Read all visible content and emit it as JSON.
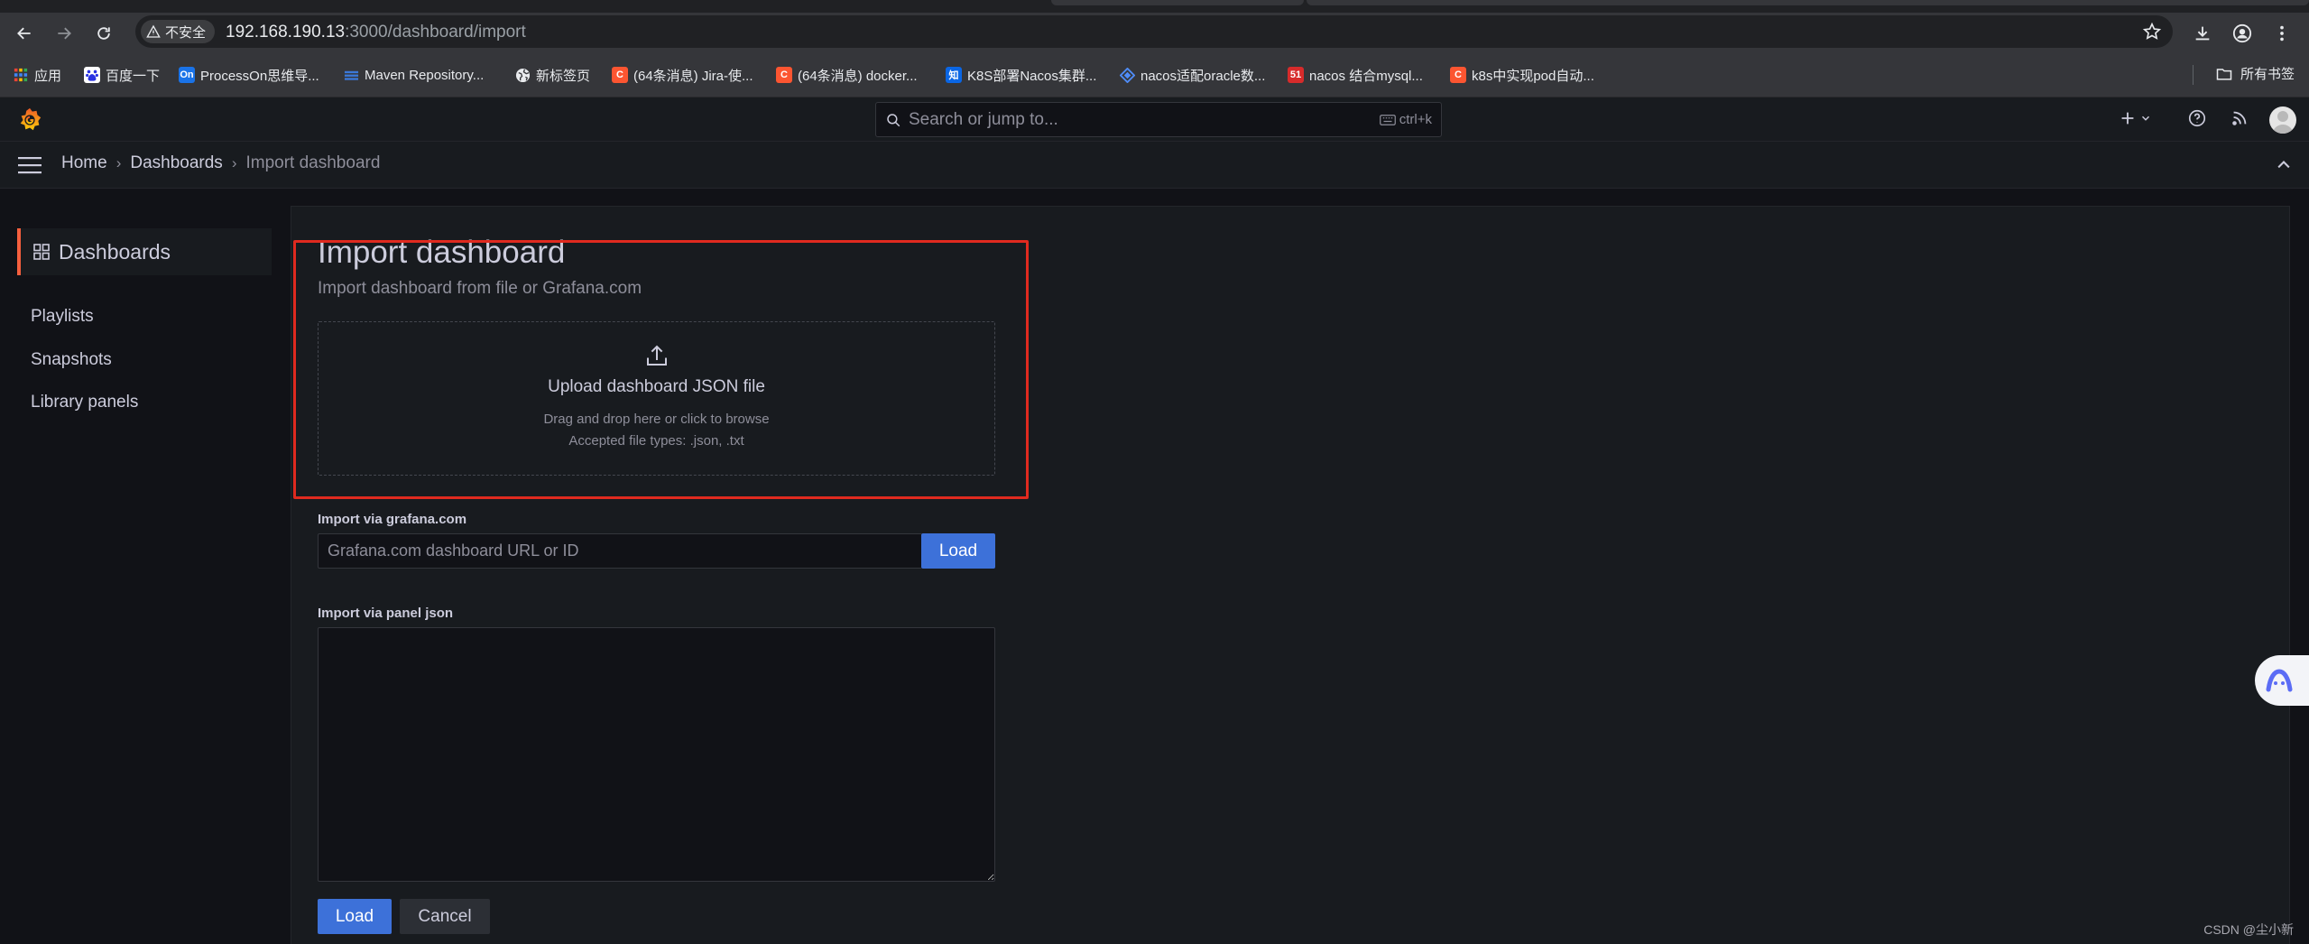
{
  "browser": {
    "security_label": "不安全",
    "url_host": "192.168.190.13",
    "url_path": ":3000/dashboard/import",
    "bookmarks": [
      {
        "label": "应用",
        "icon": "apps-grid-icon",
        "color": "#e8eaed"
      },
      {
        "label": "百度一下",
        "icon": "baidu-icon",
        "color": "#2932e1"
      },
      {
        "label": "ProcessOn思维导...",
        "icon": "processon-icon",
        "color": "#1a73e8",
        "glyph": "On"
      },
      {
        "label": "Maven Repository...",
        "icon": "maven-icon",
        "color": "#3b78d8"
      },
      {
        "label": "新标签页",
        "icon": "globe-icon",
        "color": "#e8eaed"
      },
      {
        "label": "(64条消息) Jira-使...",
        "icon": "csdn-icon",
        "color": "#fc5531",
        "glyph": "C"
      },
      {
        "label": "(64条消息) docker...",
        "icon": "csdn-icon",
        "color": "#fc5531",
        "glyph": "C"
      },
      {
        "label": "K8S部署Nacos集群...",
        "icon": "zhihu-icon",
        "color": "#0a66e5",
        "glyph": "知"
      },
      {
        "label": "nacos适配oracle数...",
        "icon": "diamond-icon",
        "color": "#4f8cf7"
      },
      {
        "label": "nacos 结合mysql...",
        "icon": "51cto-icon",
        "color": "#d72b2b",
        "glyph": "51"
      },
      {
        "label": "k8s中实现pod自动...",
        "icon": "csdn-icon",
        "color": "#fc5531",
        "glyph": "C"
      }
    ],
    "all_bookmarks": "所有书签"
  },
  "grafana": {
    "search_placeholder": "Search or jump to...",
    "search_shortcut": "ctrl+k",
    "breadcrumb": [
      "Home",
      "Dashboards",
      "Import dashboard"
    ],
    "sidebar": {
      "active": "Dashboards",
      "items": [
        "Playlists",
        "Snapshots",
        "Library panels"
      ]
    },
    "page": {
      "title": "Import dashboard",
      "subtitle": "Import dashboard from file or Grafana.com",
      "upload_title": "Upload dashboard JSON file",
      "upload_hint": "Drag and drop here or click to browse",
      "upload_types": "Accepted file types: .json, .txt",
      "gcom_label": "Import via grafana.com",
      "gcom_placeholder": "Grafana.com dashboard URL or ID",
      "gcom_load": "Load",
      "json_label": "Import via panel json",
      "load_button": "Load",
      "cancel_button": "Cancel"
    },
    "accent_color": "#f55f3e",
    "primary_color": "#3d71d9"
  },
  "watermark": "CSDN @尘小新"
}
